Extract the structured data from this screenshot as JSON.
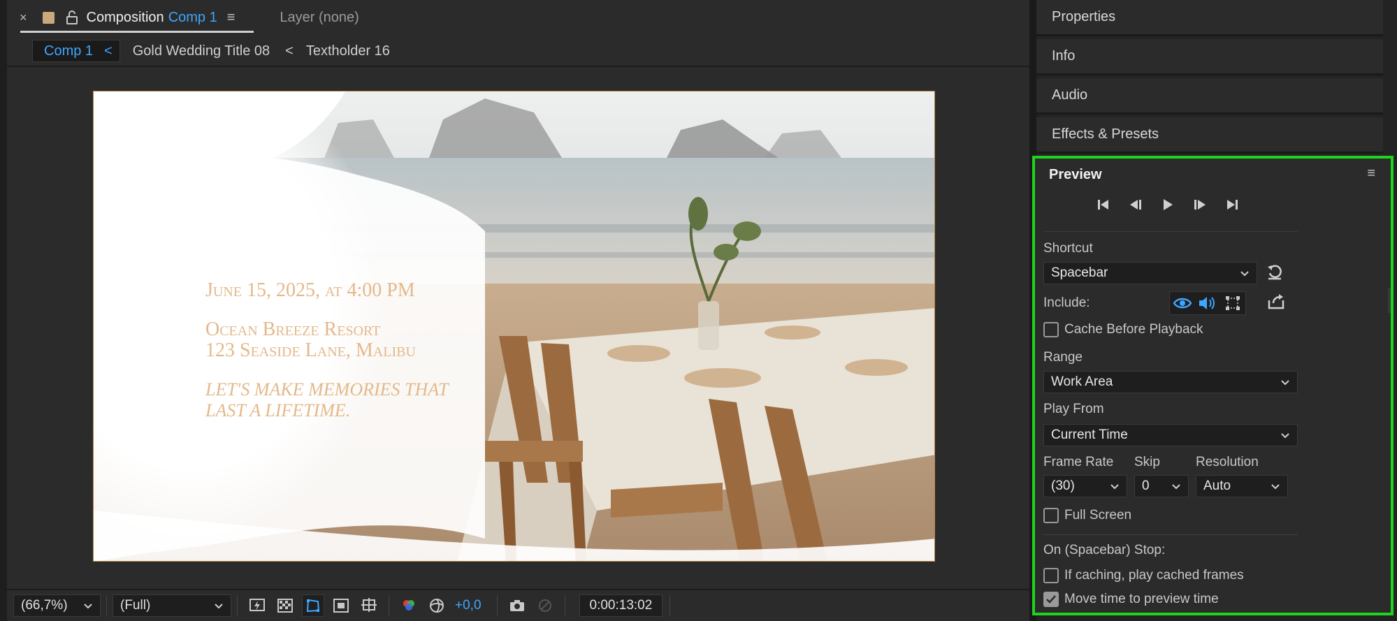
{
  "composition_tab": {
    "close_glyph": "×",
    "title": "Composition",
    "comp_name": "Comp 1",
    "menu_glyph": "≡",
    "layer_label": "Layer (none)"
  },
  "breadcrumbs": {
    "active": "Comp 1",
    "items": [
      "Gold Wedding Title 08",
      "Textholder 16"
    ]
  },
  "viewer": {
    "invite_lines": {
      "date": "June 15, 2025, at 4:00 PM",
      "venue": "Ocean Breeze Resort",
      "address": "123 Seaside Lane, Malibu",
      "tagline1": "Let's make memories that",
      "tagline2": "last a lifetime."
    }
  },
  "bottom_toolbar": {
    "zoom": "(66,7%)",
    "resolution": "(Full)",
    "exposure": "+0,0",
    "timecode": "0:00:13:02"
  },
  "right_sections": [
    "Properties",
    "Info",
    "Audio",
    "Effects & Presets"
  ],
  "preview": {
    "title": "Preview",
    "menu_glyph": "≡",
    "shortcut_label": "Shortcut",
    "shortcut_value": "Spacebar",
    "include_label": "Include:",
    "cache_before_playback": "Cache Before Playback",
    "range_label": "Range",
    "range_value": "Work Area",
    "play_from_label": "Play From",
    "play_from_value": "Current Time",
    "frame_rate_label": "Frame Rate",
    "frame_rate_value": "(30)",
    "skip_label": "Skip",
    "skip_value": "0",
    "resolution_label": "Resolution",
    "resolution_value": "Auto",
    "full_screen": "Full Screen",
    "on_stop_label": "On (Spacebar) Stop:",
    "if_caching": "If caching, play cached frames",
    "move_time": "Move time to preview time",
    "move_time_checked": true,
    "accent_color": "#1fd31f"
  },
  "colors": {
    "accent_blue": "#3ea7ff",
    "highlight_green": "#1fd31f",
    "invite_gold": "#e3b98b"
  }
}
